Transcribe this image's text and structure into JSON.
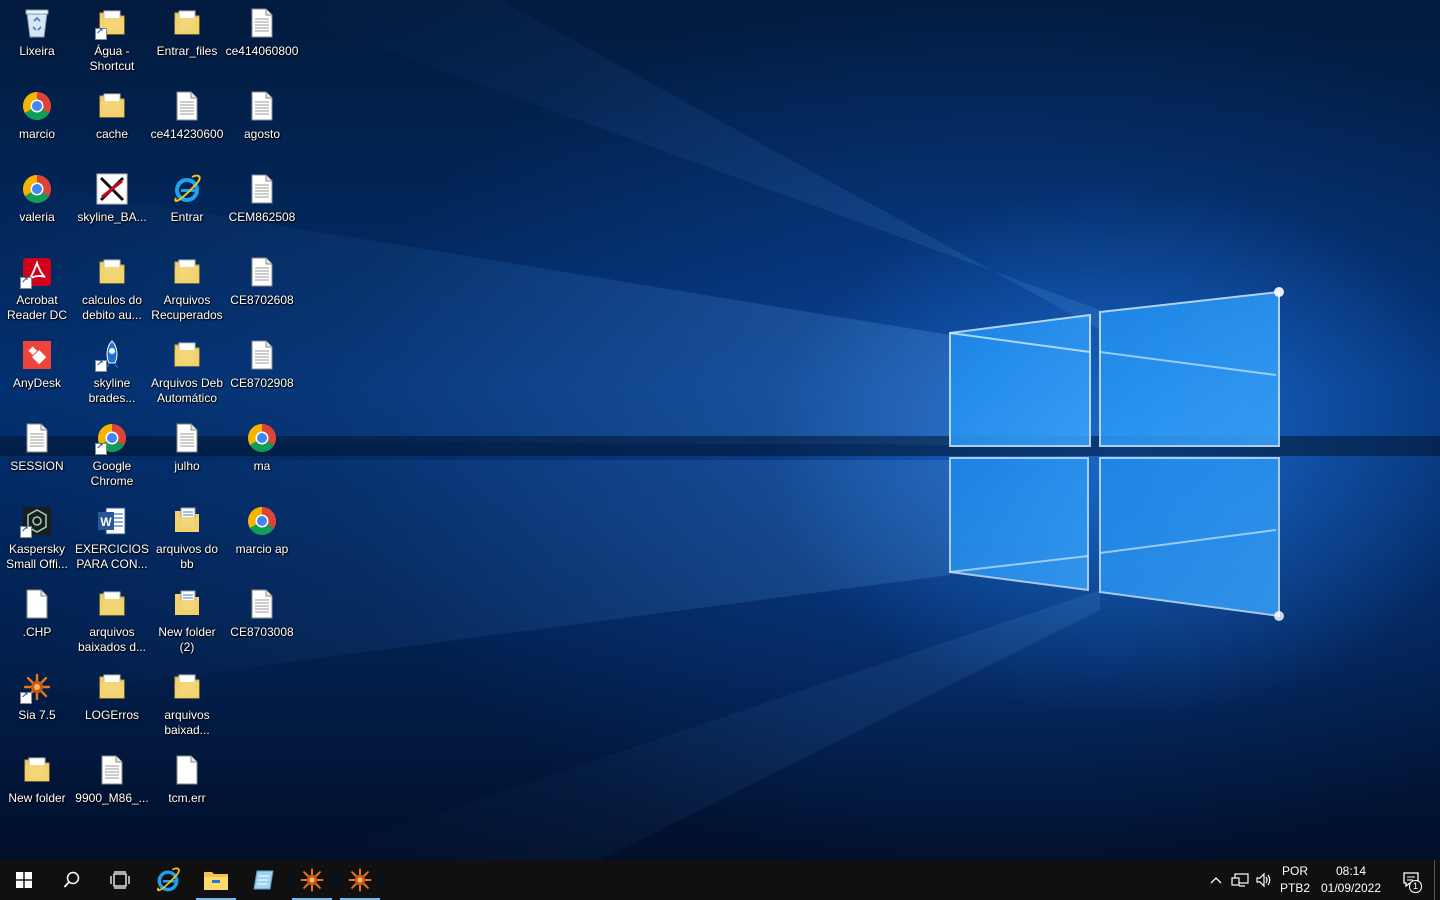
{
  "desktop": {
    "columns": [
      [
        {
          "label": "Lixeira",
          "icon": "recycle-bin-icon",
          "type": "bin"
        },
        {
          "label": "marcio",
          "icon": "chrome-icon",
          "type": "chrome"
        },
        {
          "label": "valeria",
          "icon": "chrome-icon",
          "type": "chrome"
        },
        {
          "label": "Acrobat Reader DC",
          "icon": "acrobat-icon",
          "type": "acrobat",
          "shortcut": true
        },
        {
          "label": "AnyDesk",
          "icon": "anydesk-icon",
          "type": "anydesk"
        },
        {
          "label": "SESSION",
          "icon": "document-icon",
          "type": "doc"
        },
        {
          "label": "Kaspersky Small Offi...",
          "icon": "kaspersky-icon",
          "type": "kaspersky",
          "shortcut": true
        },
        {
          "label": ".CHP",
          "icon": "blank-file-icon",
          "type": "blank"
        },
        {
          "label": "Sia 7.5",
          "icon": "sia-icon",
          "type": "sia",
          "shortcut": true
        },
        {
          "label": "New folder",
          "icon": "folder-icon",
          "type": "folder"
        }
      ],
      [
        {
          "label": "Água - Shortcut",
          "icon": "folder-icon",
          "type": "folder",
          "shortcut": true
        },
        {
          "label": "cache",
          "icon": "folder-icon",
          "type": "folder"
        },
        {
          "label": "skyline_BA...",
          "icon": "skyline-ba-icon",
          "type": "skyx"
        },
        {
          "label": "calculos do debito au...",
          "icon": "folder-icon",
          "type": "folder"
        },
        {
          "label": "skyline brades...",
          "icon": "skyline-bradesco-icon",
          "type": "rocket",
          "shortcut": true
        },
        {
          "label": "Google Chrome",
          "icon": "chrome-icon",
          "type": "chrome",
          "shortcut": true
        },
        {
          "label": "EXERCICIOS PARA CON...",
          "icon": "word-document-icon",
          "type": "word"
        },
        {
          "label": "arquivos baixados d...",
          "icon": "folder-icon",
          "type": "folder"
        },
        {
          "label": "LOGErros",
          "icon": "folder-icon",
          "type": "folder"
        },
        {
          "label": "9900_M86_...",
          "icon": "document-icon",
          "type": "doc"
        }
      ],
      [
        {
          "label": "Entrar_files",
          "icon": "folder-icon",
          "type": "folder"
        },
        {
          "label": "ce414230600",
          "icon": "document-icon",
          "type": "doc"
        },
        {
          "label": "Entrar",
          "icon": "internet-explorer-icon",
          "type": "ie"
        },
        {
          "label": "Arquivos Recuperados",
          "icon": "folder-icon",
          "type": "folder"
        },
        {
          "label": "Arquivos Deb Automático",
          "icon": "folder-icon",
          "type": "folder"
        },
        {
          "label": "julho",
          "icon": "document-icon",
          "type": "doc"
        },
        {
          "label": "arquivos do bb",
          "icon": "folder-icon",
          "type": "folderdocs"
        },
        {
          "label": "New folder (2)",
          "icon": "folder-icon",
          "type": "folderdocs"
        },
        {
          "label": "arquivos baixad...",
          "icon": "folder-icon",
          "type": "folder"
        },
        {
          "label": "tcm.err",
          "icon": "blank-file-icon",
          "type": "blank"
        }
      ],
      [
        {
          "label": "ce414060800",
          "icon": "document-icon",
          "type": "doc"
        },
        {
          "label": "agosto",
          "icon": "document-icon",
          "type": "doc"
        },
        {
          "label": "CEM862508",
          "icon": "document-icon",
          "type": "doc"
        },
        {
          "label": "CE8702608",
          "icon": "document-icon",
          "type": "doc"
        },
        {
          "label": "CE8702908",
          "icon": "document-icon",
          "type": "doc"
        },
        {
          "label": "ma",
          "icon": "chrome-icon",
          "type": "chrome"
        },
        {
          "label": "marcio ap",
          "icon": "chrome-icon",
          "type": "chrome"
        },
        {
          "label": "CE8703008",
          "icon": "document-icon",
          "type": "doc"
        }
      ]
    ]
  },
  "taskbar": {
    "buttons": [
      {
        "name": "start-button",
        "icon": "windows-logo-icon"
      },
      {
        "name": "search-button",
        "icon": "search-icon"
      },
      {
        "name": "task-view-button",
        "icon": "task-view-icon"
      },
      {
        "name": "taskbar-internet-explorer",
        "icon": "internet-explorer-icon"
      },
      {
        "name": "taskbar-file-explorer",
        "icon": "file-explorer-icon",
        "active": true
      },
      {
        "name": "taskbar-notepad-app",
        "icon": "notepad-icon"
      },
      {
        "name": "taskbar-sia-app-1",
        "icon": "sia-icon",
        "active": true
      },
      {
        "name": "taskbar-sia-app-2",
        "icon": "sia-icon",
        "active": true
      }
    ],
    "tray": {
      "language": "POR",
      "keyboard": "PTB2",
      "time": "08:14",
      "date": "01/09/2022",
      "notification_count": "1"
    }
  },
  "colors": {
    "taskbar": "#101010",
    "accent": "#76b9ed",
    "folder": "#f3d26b",
    "chrome_red": "#db4437",
    "chrome_yellow": "#f4b400",
    "chrome_green": "#0f9d58",
    "chrome_blue": "#4285f4"
  }
}
